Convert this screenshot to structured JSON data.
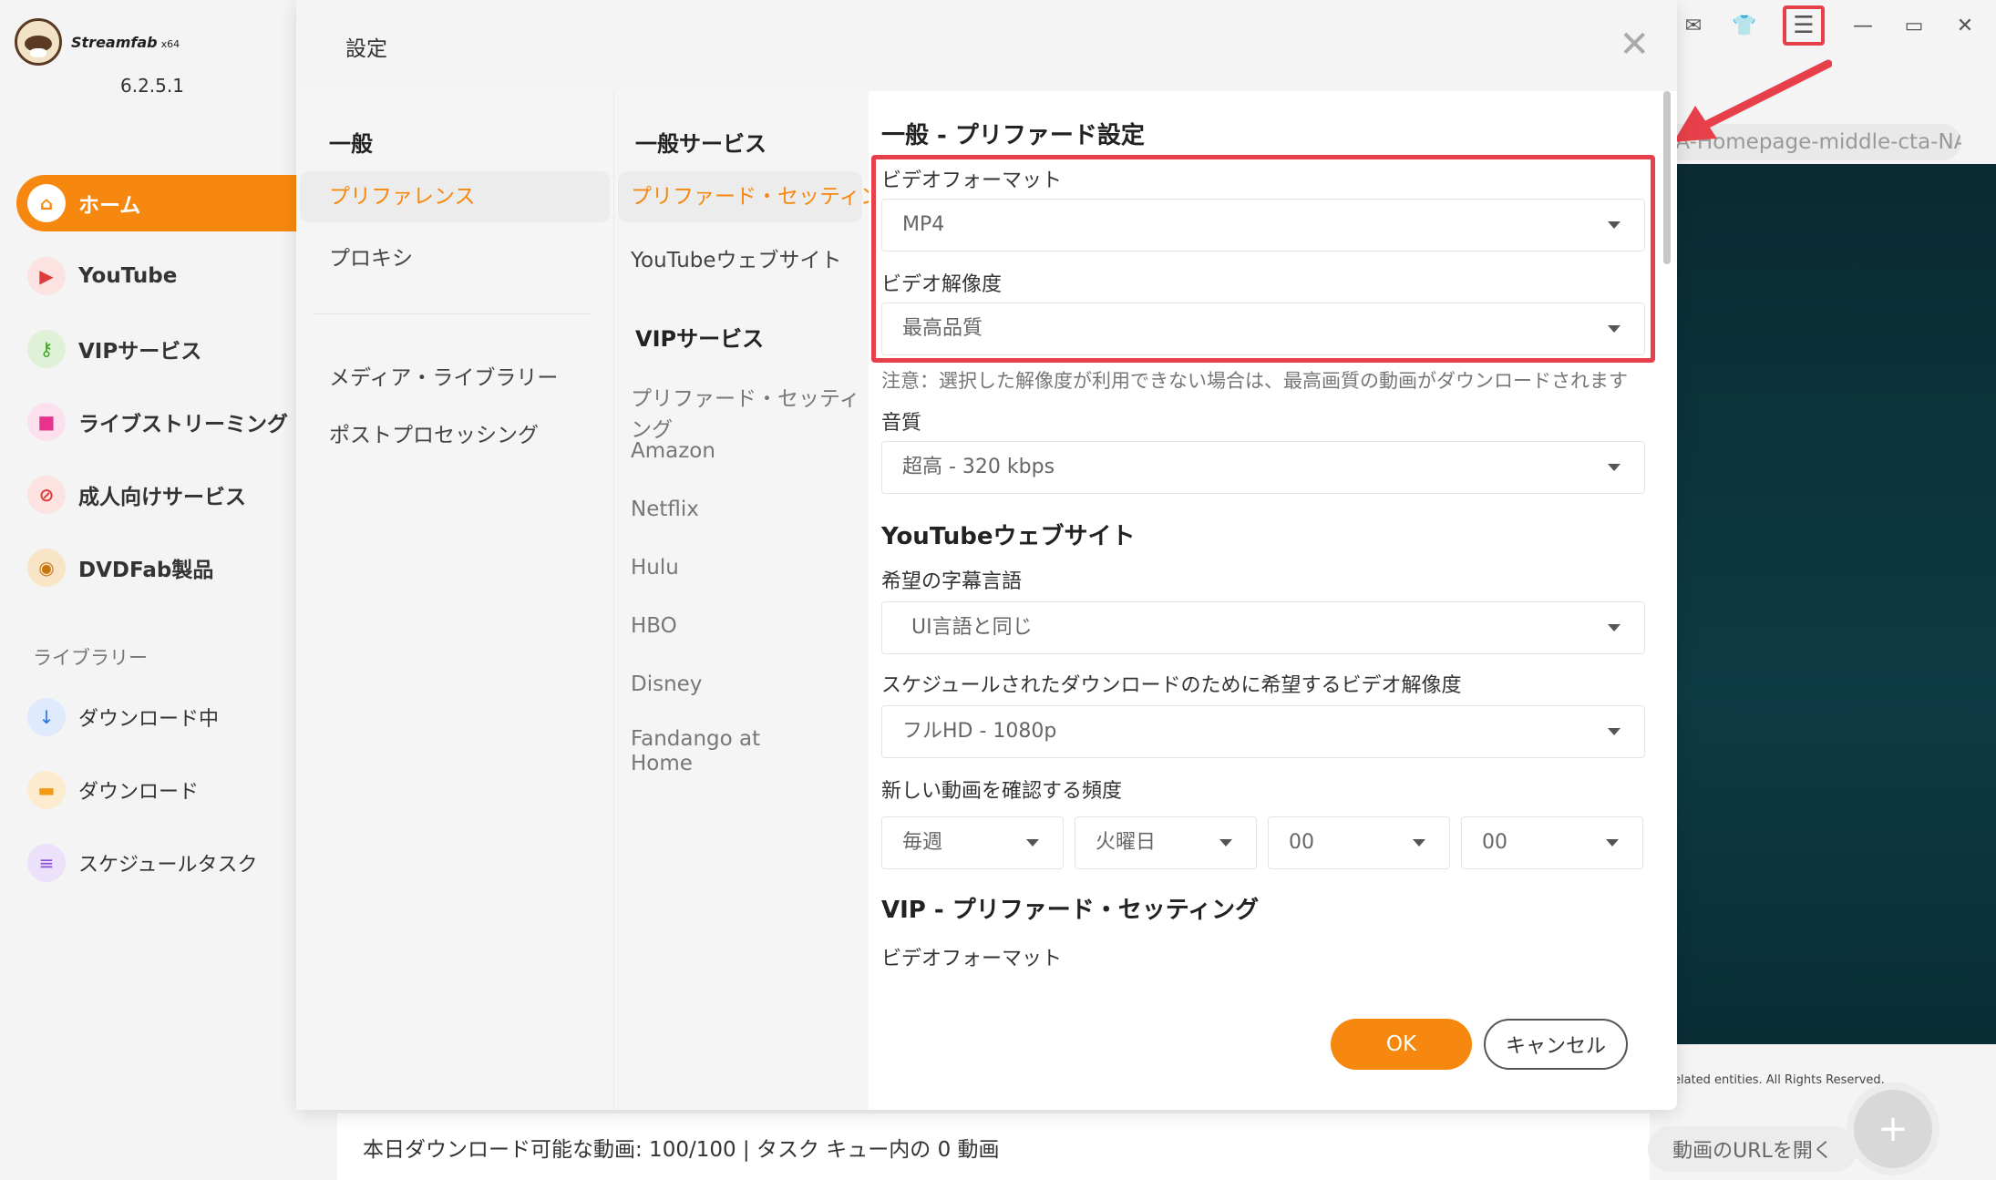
{
  "app": {
    "name": "Streamfab",
    "arch": "x64",
    "version": "6.2.5.1"
  },
  "sidebar": {
    "items": [
      {
        "label": "ホーム",
        "icon": "home-icon"
      },
      {
        "label": "YouTube",
        "icon": "youtube-icon"
      },
      {
        "label": "VIPサービス",
        "icon": "key-icon"
      },
      {
        "label": "ライブストリーミング",
        "icon": "video-camera-icon"
      },
      {
        "label": "成人向けサービス",
        "icon": "adult-block-icon"
      },
      {
        "label": "DVDFab製品",
        "icon": "dvdfab-icon"
      }
    ],
    "library_label": "ライブラリー",
    "library_items": [
      {
        "label": "ダウンロード中",
        "icon": "download-arrow-icon"
      },
      {
        "label": "ダウンロード",
        "icon": "folder-icon"
      },
      {
        "label": "スケジュールタスク",
        "icon": "task-list-icon"
      }
    ]
  },
  "topbar": {
    "icons": [
      "mail-icon",
      "shirt-icon",
      "menu-icon",
      "minimize-icon",
      "maximize-icon",
      "close-icon"
    ]
  },
  "background": {
    "url_chip": "JA-Homepage-middle-cta-NA",
    "copyright": "elated entities. All Rights Reserved.",
    "status": "本日ダウンロード可能な動画: 100/100 | タスク キュー内の 0 動画",
    "open_url": "動画のURLを開く",
    "fab": "+"
  },
  "dialog": {
    "title": "設定",
    "col1": {
      "header": "一般",
      "items": [
        "プリファレンス",
        "プロキシ"
      ],
      "items2": [
        "メディア・ライブラリー",
        "ポストプロセッシング"
      ]
    },
    "col2": {
      "header1": "一般サービス",
      "items1": [
        "プリファード・セッティング",
        "YouTubeウェブサイト"
      ],
      "header2": "VIPサービス",
      "items2": [
        "プリファード・セッティング",
        "Amazon",
        "Netflix",
        "Hulu",
        "HBO",
        "Disney",
        "Fandango at Home"
      ]
    },
    "content": {
      "general_title": "一般 - プリファード設定",
      "video_format_label": "ビデオフォーマット",
      "video_format_value": "MP4",
      "resolution_label": "ビデオ解像度",
      "resolution_value": "最高品質",
      "resolution_note": "注意：選択した解像度が利用できない場合は、最高画質の動画がダウンロードされます",
      "audio_label": "音質",
      "audio_value": "超高 - 320 kbps",
      "youtube_title": "YouTubeウェブサイト",
      "subtitle_label": "希望の字幕言語",
      "subtitle_value": "UI言語と同じ",
      "sched_res_label": "スケジュールされたダウンロードのために希望するビデオ解像度",
      "sched_res_value": "フルHD - 1080p",
      "freq_label": "新しい動画を確認する頻度",
      "freq_values": [
        "毎週",
        "火曜日",
        "00",
        "00"
      ],
      "vip_title": "VIP - プリファード・セッティング",
      "vip_format_label": "ビデオフォーマット"
    },
    "ok": "OK",
    "cancel": "キャンセル"
  }
}
